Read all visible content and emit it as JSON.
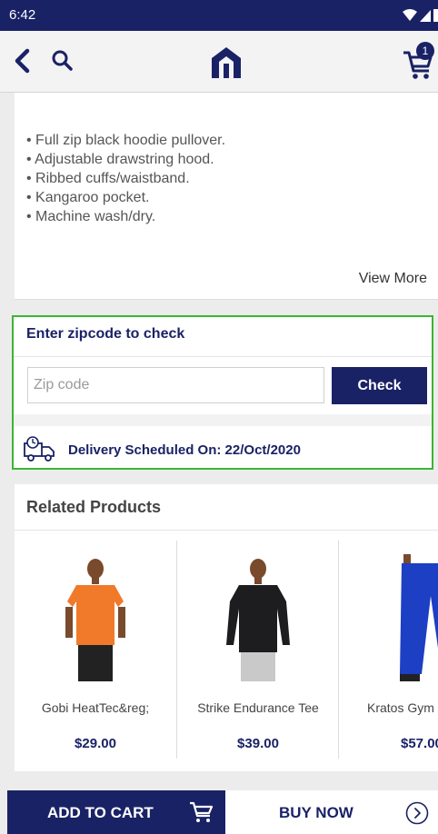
{
  "status_bar": {
    "time": "6:42"
  },
  "header": {
    "cart_count": "1"
  },
  "description": {
    "features": [
      "Full zip black hoodie pullover.",
      "Adjustable drawstring hood.",
      "Ribbed cuffs/waistband.",
      "Kangaroo pocket.",
      "Machine wash/dry."
    ],
    "view_more_label": "View More"
  },
  "zipcode": {
    "title": "Enter zipcode to check",
    "placeholder": "Zip code",
    "value": "",
    "check_label": "Check",
    "delivery_text": "Delivery Scheduled On: 22/Oct/2020"
  },
  "related": {
    "title": "Related Products",
    "products": [
      {
        "name": "Gobi HeatTec&reg;",
        "price": "$29.00"
      },
      {
        "name": "Strike Endurance Tee",
        "price": "$39.00"
      },
      {
        "name": "Kratos Gym",
        "price": "$57.00"
      }
    ]
  },
  "bottom_bar": {
    "add_to_cart_label": "ADD TO CART",
    "buy_now_label": "BUY NOW"
  },
  "colors": {
    "primary": "#1a2266",
    "highlight_border": "#3cb52f",
    "shirt_orange": "#f07a2a",
    "shirt_black": "#1d1d1f",
    "pants_blue": "#1c3fc4"
  },
  "icons": [
    "back-icon",
    "search-icon",
    "logo-icon",
    "cart-icon",
    "truck-icon",
    "chevron-right-icon",
    "wifi-icon",
    "signal-icon",
    "battery-icon"
  ]
}
